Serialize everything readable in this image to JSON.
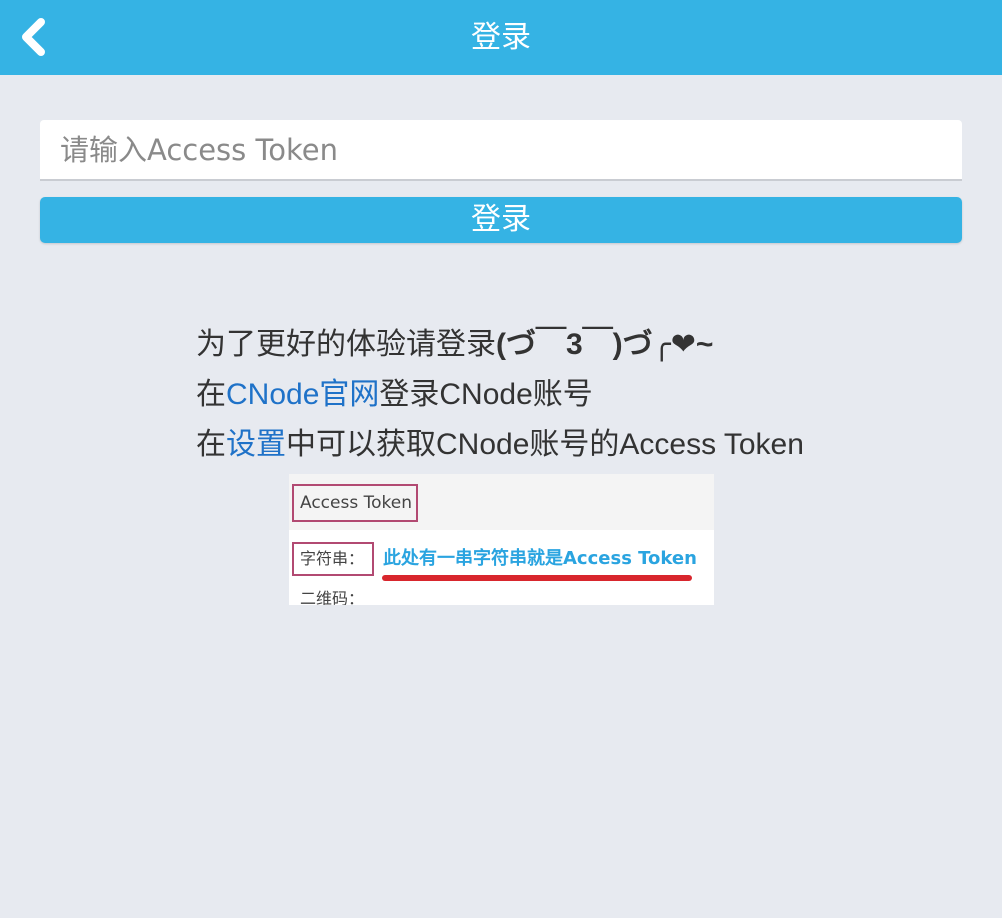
{
  "header": {
    "title": "登录",
    "back_icon": "chevron-left-icon"
  },
  "form": {
    "token_placeholder": "请输入Access Token",
    "token_value": "",
    "login_label": "登录"
  },
  "info": {
    "line1_text": "为了更好的体验请登录",
    "line1_emoticon": "(づ￣3￣)づ╭❤~",
    "line2_prefix": "在",
    "line2_link": "CNode官网",
    "line2_suffix": "登录CNode账号",
    "line3_prefix": "在",
    "line3_link": "设置",
    "line3_suffix": "中可以获取CNode账号的Access Token"
  },
  "example_image": {
    "title_box": "Access Token",
    "string_label": "字符串：",
    "note": "此处有一串字符串就是Access Token",
    "qr_label": "二维码："
  },
  "colors": {
    "header": "#35b3e4",
    "button": "#35b3e4",
    "link": "#1f72c8",
    "background": "#e7eaf0"
  }
}
